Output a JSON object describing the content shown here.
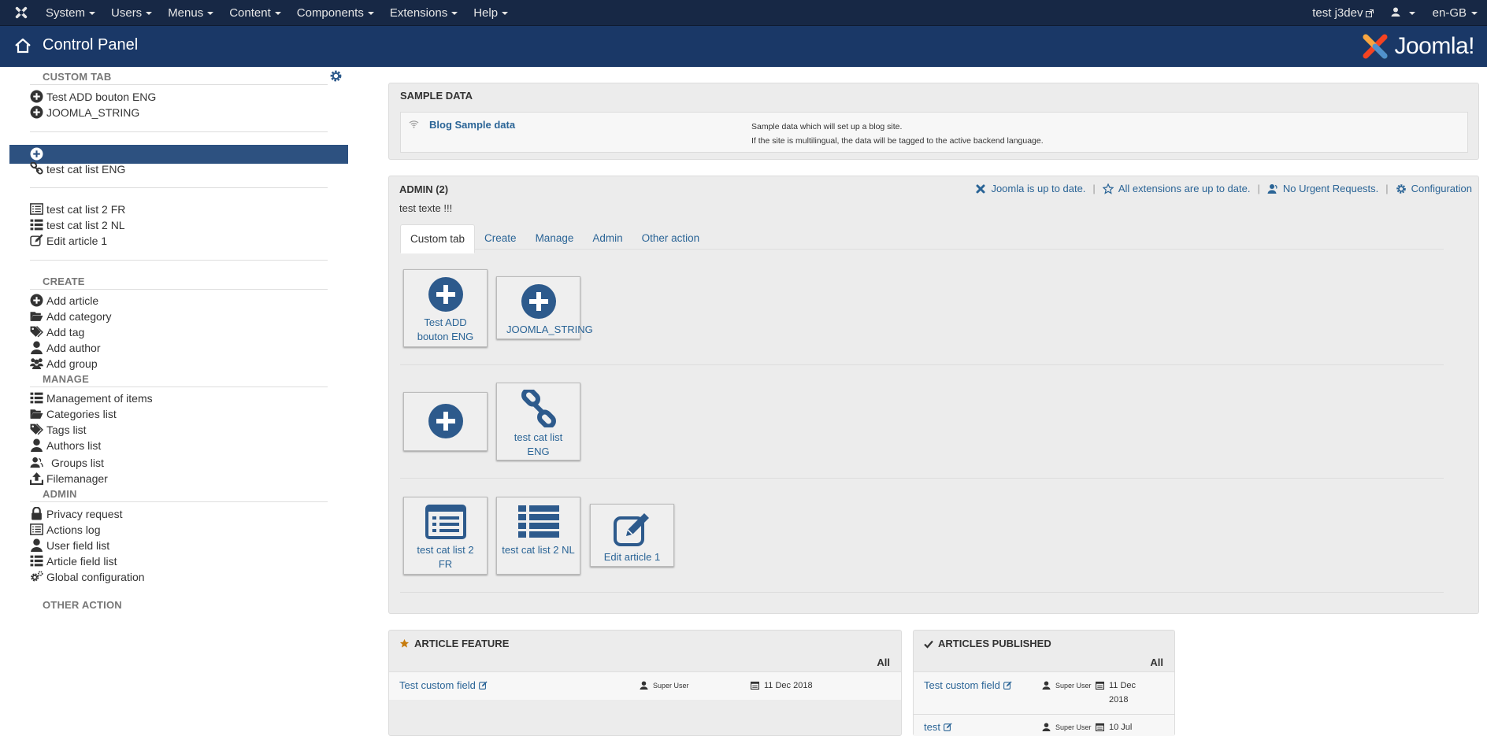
{
  "topnav": {
    "menus": [
      "System",
      "Users",
      "Menus",
      "Content",
      "Components",
      "Extensions",
      "Help"
    ],
    "site_link": "test j3dev",
    "user_menu": "",
    "language": "en-GB"
  },
  "header": {
    "title": "Control Panel",
    "brand": "Joomla!"
  },
  "sidebar": {
    "custom_tab_heading": "CUSTOM TAB",
    "custom_items": [
      "Test ADD bouton ENG",
      "JOOMLA_STRING"
    ],
    "group2_items": [
      "",
      "test cat list ENG"
    ],
    "group3_items": [
      "test cat list 2 FR",
      "test cat list 2 NL",
      "Edit article 1"
    ],
    "create_heading": "CREATE",
    "create_items": [
      "Add article",
      "Add category",
      "Add tag",
      "Add author",
      "Add group"
    ],
    "manage_heading": "MANAGE",
    "manage_items": [
      "Management of items",
      "Categories list",
      "Tags list",
      "Authors list",
      "Groups list",
      "Filemanager"
    ],
    "admin_heading": "ADMIN",
    "admin_items": [
      "Privacy request",
      "Actions log",
      "User field list",
      "Article field list",
      "Global configuration"
    ],
    "other_heading": "OTHER ACTION"
  },
  "sample_data": {
    "title": "SAMPLE DATA",
    "link": "Blog Sample data",
    "desc_line1": "Sample data which will set up a blog site.",
    "desc_line2": "If the site is multilingual, the data will be tagged to the active backend language."
  },
  "admin_panel": {
    "title": "ADMIN (2)",
    "status": [
      "Joomla is up to date.",
      "All extensions are up to date.",
      "No Urgent Requests.",
      "Configuration"
    ],
    "text": "test texte !!!",
    "tabs": [
      "Custom tab",
      "Create",
      "Manage",
      "Admin",
      "Other action"
    ],
    "buttons_row1": [
      "Test ADD bouton ENG",
      "JOOMLA_STRING"
    ],
    "buttons_row2": [
      "",
      "test cat list ENG"
    ],
    "buttons_row3": [
      "test cat list 2 FR",
      "test cat list 2 NL",
      "Edit article 1"
    ]
  },
  "article_feature": {
    "title": "ARTICLE FEATURE",
    "all": "All",
    "rows": [
      {
        "title": "Test custom field",
        "author": "Super User",
        "date": "11 Dec 2018"
      }
    ]
  },
  "articles_published": {
    "title": "ARTICLES PUBLISHED",
    "all": "All",
    "rows": [
      {
        "title": "Test custom field",
        "author": "Super User",
        "date_line1": "11 Dec",
        "date_line2": "2018"
      },
      {
        "title": "test",
        "author": "Super User",
        "date_line1": "10 Jul",
        "date_line2": ""
      }
    ]
  },
  "colors": {
    "nav": "#172845",
    "header": "#1a3867",
    "active": "#2d5180",
    "link": "#2a6496",
    "icon": "#2d5a8c"
  }
}
